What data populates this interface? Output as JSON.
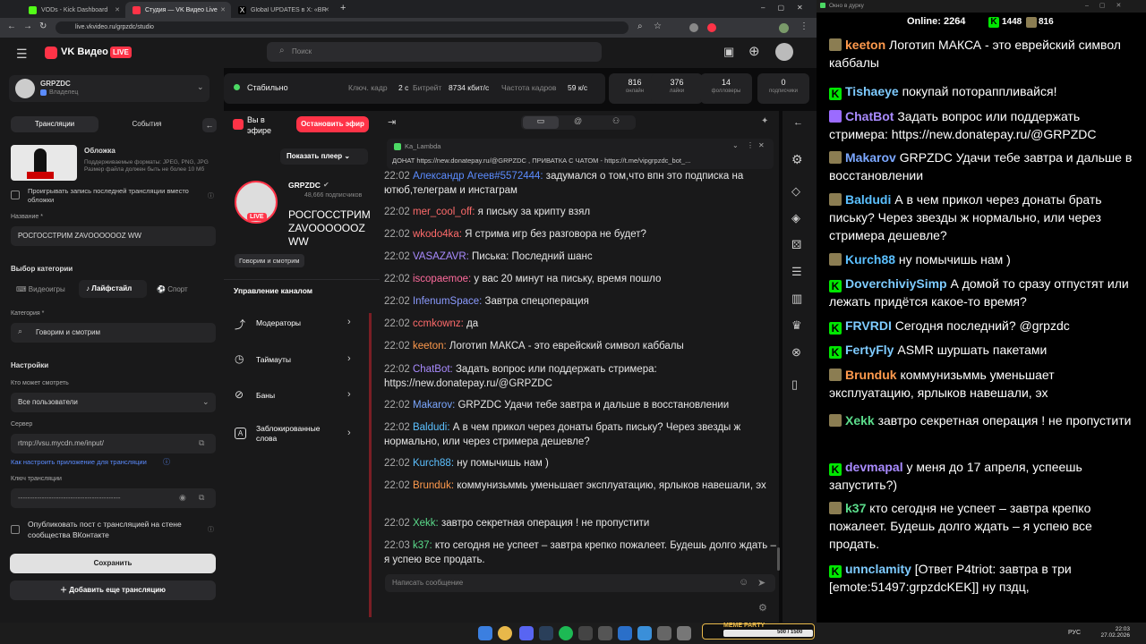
{
  "browser": {
    "tabs": [
      {
        "title": "VODs - Kick Dashboard",
        "color": "#53fc18"
      },
      {
        "title": "Студия — VK Видео Live",
        "color": "#ff3347"
      },
      {
        "title": "Global UPDATES в X: «BREAKIN",
        "color": "#ffffff"
      }
    ],
    "new_tab": "+",
    "url": "live.vkvideo.ru/grpzdc/studio"
  },
  "vk": {
    "logo": "VK Видео",
    "live_badge": "LIVE",
    "search_placeholder": "Поиск",
    "channel_name": "GRPZDC",
    "channel_role": "Владелец",
    "status": "Стабильно",
    "keyframe_label": "Ключ. кадр",
    "keyframe_value": "2 с",
    "bitrate_label": "Битрейт",
    "bitrate_value": "8734 кбит/с",
    "fps_label": "Частота кадров",
    "fps_value": "59 к/с",
    "stats": [
      {
        "value": "816",
        "label": "онлайн"
      },
      {
        "value": "376",
        "label": "лайки"
      },
      {
        "value": "14",
        "label": "фолловеры"
      },
      {
        "value": "0",
        "label": "подписчики"
      }
    ]
  },
  "left": {
    "tab_streams": "Трансляции",
    "tab_events": "События",
    "cover_title": "Обложка",
    "cover_hint": "Поддерживаемые форматы: JPEG, PNG, JPG Размер файла должен быть не более 10 Мб",
    "auto_cover": "Проигрывать запись последней трансляции вместо обложки",
    "name_label": "Название *",
    "name_value": "РОСГОССТРИМ ZAVOOOOOOZ WW",
    "category_choice": "Выбор категории",
    "cat_games": "Видеоигры",
    "cat_lifestyle": "Лайфстайл",
    "cat_sport": "Спорт",
    "category_label": "Категория *",
    "category_value": "Говорим и смотрим",
    "settings": "Настройки",
    "who_can_watch": "Кто может смотреть",
    "who_value": "Все пользователи",
    "server_label": "Сервер",
    "server_value": "rtmp://vsu.mycdn.me/input/",
    "setup_link": "Как настроить приложение для трансляции",
    "key_label": "Ключ трансляции",
    "key_value": "-------------------------------------------",
    "publish_post": "Опубликовать пост с трансляцией на стене сообщества ВКонтакте",
    "save": "Сохранить",
    "add_stream": "Добавить еще трансляцию"
  },
  "center": {
    "on_air": "Вы в эфире",
    "stop": "Остановить эфир",
    "show_player": "Показать плеер",
    "channel": "GRPZDC",
    "subscribers": "48,666 подписчиков",
    "stream_title": "РОСГОССТРИМ ZAVOOOOOOZ WW",
    "category_tag": "Говорим и смотрим",
    "manage": "Управление каналом",
    "menu": [
      {
        "label": "Модераторы",
        "icon": "rocket-icon"
      },
      {
        "label": "Таймауты",
        "icon": "clock-icon"
      },
      {
        "label": "Баны",
        "icon": "ban-icon"
      },
      {
        "label": "Заблокированные слова",
        "icon": "font-icon"
      }
    ]
  },
  "chat": {
    "pinned_user": "Ka_Lambda",
    "pinned_text": "ДОНАТ https://new.donatepay.ru/@GRPZDC , ПРИВАТКА С ЧАТОМ - https://t.me/vipgrpzdc_bot_...",
    "input_placeholder": "Написать сообщение",
    "messages": [
      {
        "time": "22:02",
        "user": "Александр Агеев#5572444:",
        "color": "#5b8cff",
        "text": "задумался о том,что впн это подписка на ютюб,телеграм и инстаграм"
      },
      {
        "time": "22:02",
        "user": "mer_cool_off:",
        "color": "#ff6b6b",
        "text": "я письку за крипту взял"
      },
      {
        "time": "22:02",
        "user": "wkodo4ka:",
        "color": "#ff6b6b",
        "text": "Я стрима игр без разговора не будет?"
      },
      {
        "time": "22:02",
        "user": "VASAZAVR:",
        "color": "#a98bff",
        "text": "Писька: Последний шанс"
      },
      {
        "time": "22:02",
        "user": "iscopaemoe:",
        "color": "#ff6b9d",
        "text": "у вас 20 минут на письку, время пошло"
      },
      {
        "time": "22:02",
        "user": "InfenumSpace:",
        "color": "#8b9bff",
        "text": "Завтра спецоперация"
      },
      {
        "time": "22:02",
        "user": "ccmkownz:",
        "color": "#ff6b6b",
        "text": "да"
      },
      {
        "time": "22:02",
        "user": "keeton:",
        "color": "#ff9a4d",
        "text": "Логотип МАКСА - это еврейский символ каббалы"
      },
      {
        "time": "22:02",
        "user": "ChatBot:",
        "color": "#a98bff",
        "text": "Задать вопрос или поддержать стримера: https://new.donatepay.ru/@GRPZDC"
      },
      {
        "time": "22:02",
        "user": "Makarov:",
        "color": "#7ba7ff",
        "text": "GRPZDC Удачи тебе завтра и дальше в восстановлении"
      },
      {
        "time": "22:02",
        "user": "Baldudi:",
        "color": "#5bc0ff",
        "text": "А в чем прикол через донаты брать письку? Через звезды ж нормально, или через стримера дешевле?"
      },
      {
        "time": "22:02",
        "user": "Kurch88:",
        "color": "#5bc0ff",
        "text": "ну помычишь нам )"
      },
      {
        "time": "22:02",
        "user": "Brunduk:",
        "color": "#ff9a4d",
        "text": "коммунизьммь уменьшает эксплуатацию, ярлыков навешали, эх"
      },
      {
        "time": "22:02",
        "user": "Xekk:",
        "color": "#5bdc8b",
        "text": "завтро секретная операция ! не пропустити"
      },
      {
        "time": "22:03",
        "user": "k37:",
        "color": "#5bdc8b",
        "text": "кто сегодня не успеет – завтра крепко пожалеет. Будешь долго ждать – я успею все продать."
      }
    ]
  },
  "overlay": {
    "window_title": "Окно в дурку",
    "online_label": "Online:",
    "online_value": "2264",
    "kick_count": "1448",
    "vk_count": "816",
    "messages": [
      {
        "user": "keeton",
        "color": "#ff9a4d",
        "text": "Логотип МАКСА - это еврейский символ каббалы",
        "badge": "cat"
      },
      {
        "user": "Tishaeye",
        "color": "#7ecbff",
        "text": "покупай потораппливайся!",
        "badge": "kick"
      },
      {
        "user": "ChatBot",
        "color": "#a98bff",
        "text": "Задать вопрос или поддержать стримера: https://new.donatepay.ru/@GRPZDC",
        "badge": "bot"
      },
      {
        "user": "Makarov",
        "color": "#7ba7ff",
        "text": "GRPZDC Удачи тебе завтра и дальше в восстановлении",
        "badge": "cat"
      },
      {
        "user": "Baldudi",
        "color": "#5bc0ff",
        "text": "А в чем прикол через донаты брать письку? Через звезды ж нормально, или через стримера дешевле?",
        "badge": "cat"
      },
      {
        "user": "Kurch88",
        "color": "#5bc0ff",
        "text": "ну помычишь нам )",
        "badge": "cat"
      },
      {
        "user": "DoverchiviySimp",
        "color": "#7ecbff",
        "text": "А домой то сразу отпустят или лежать придётся какое-то время?",
        "badge": "kick"
      },
      {
        "user": "FRVRDI",
        "color": "#7ecbff",
        "text": "Сегодня последний? @grpzdc",
        "badge": "kick"
      },
      {
        "user": "FertyFly",
        "color": "#7ecbff",
        "text": "ASMR шуршать пакетами",
        "badge": "kick"
      },
      {
        "user": "Brunduk",
        "color": "#ff9a4d",
        "text": "коммунизьммь уменьшает эксплуатацию, ярлыков навешали, эх",
        "badge": "cat"
      },
      {
        "user": "Xekk",
        "color": "#5bdc8b",
        "text": "завтро секретная операция ! не пропустити",
        "badge": "cat"
      },
      {
        "user": "devmapal",
        "color": "#a98bff",
        "text": "у меня до 17 апреля, успеешь запустить?)",
        "badge": "kick"
      },
      {
        "user": "k37",
        "color": "#5bdc8b",
        "text": "кто сегодня не успеет – завтра крепко пожалеет. Будешь долго ждать – я успею все продать.",
        "badge": "cat"
      },
      {
        "user": "unnclamity",
        "color": "#7ecbff",
        "text": "[Ответ P4triot: завтра в три [emote:51497:grpzdcKEK]] ну пздц,",
        "badge": "kick"
      }
    ]
  },
  "taskbar": {
    "lang": "РУС",
    "time": "22:03",
    "date": "27.02.2026",
    "party_label": "MEME PARTY",
    "party_progress": "500 / 1500"
  },
  "colors": {
    "accent_red": "#ff3347",
    "kick_green": "#00e701",
    "link_blue": "#5b8cff"
  }
}
